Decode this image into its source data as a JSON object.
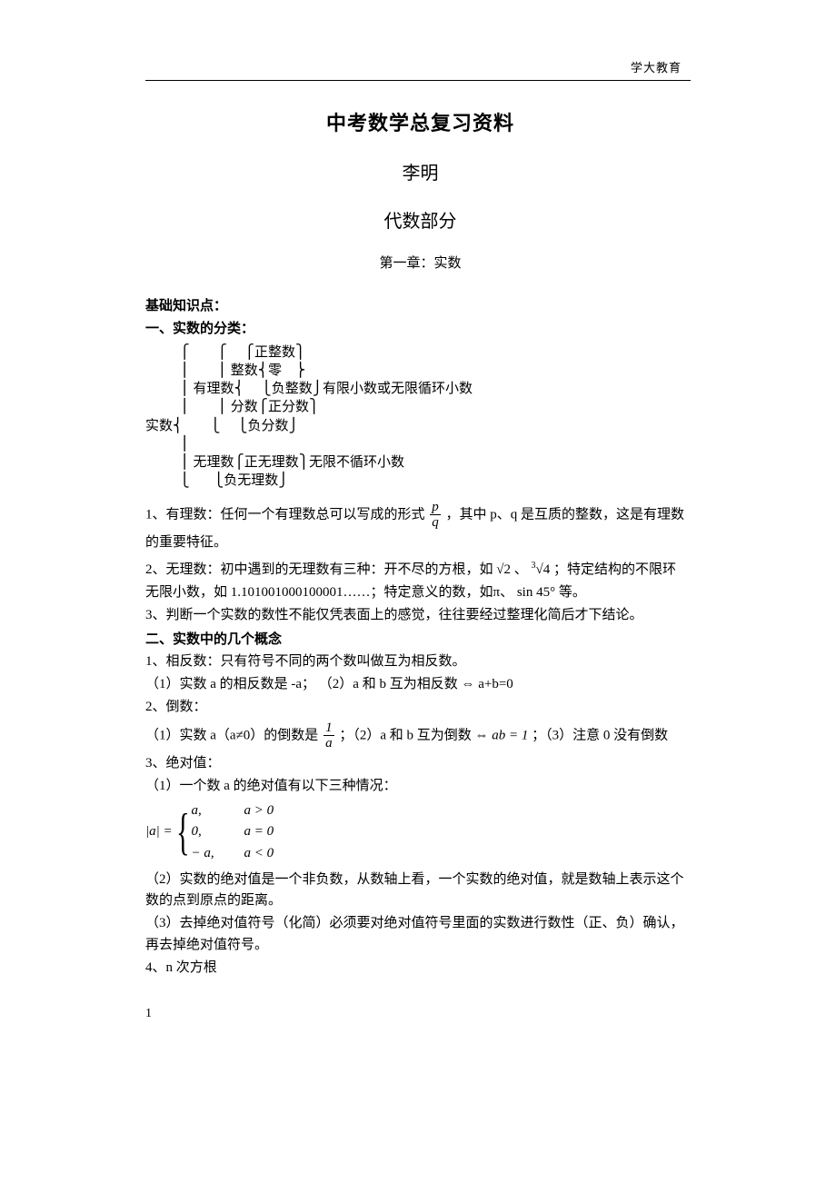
{
  "header": {
    "brand": "学大教育"
  },
  "title": "中考数学总复习资料",
  "author": "李明",
  "section": "代数部分",
  "chapter": "第一章：实数",
  "h_basic": "基础知识点：",
  "h1": "一、实数的分类：",
  "tree": "          ⎧        ⎧     ⎧正整数⎫\n          ⎪        ⎪ 整数⎨零    ⎬\n          ⎪ 有理数⎨     ⎩负整数⎭有限小数或无限循环小数\n          ⎪        ⎪ 分数⎧正分数⎫\n实数⎨        ⎩     ⎩负分数⎭\n          ⎪\n          ⎪ 无理数⎧正无理数⎫无限不循环小数\n          ⎩       ⎩负无理数⎭",
  "p1a": "1、有理数：任何一个有理数总可以写成的形式",
  "p1b": "，其中 p、q 是互质的整数，这是有理数",
  "p1c": "的重要特征。",
  "frac_pq": {
    "num": "p",
    "den": "q"
  },
  "p2a": "2、无理数：初中遇到的无理数有三种：开不尽的方根，如",
  "p2r1": "√2",
  "p2sep": "、",
  "p2r2_idx": "3",
  "p2r2": "√4",
  "p2b": "；特定结构的不限环",
  "p2c": "无限小数，如 1.101001000100001……；特定意义的数，如π、",
  "p2sin": "sin 45°",
  "p2d": " 等。",
  "p3": "3、判断一个实数的数性不能仅凭表面上的感觉，往往要经过整理化简后才下结论。",
  "h2": "二、实数中的几个概念",
  "c1": "1、相反数：只有符号不同的两个数叫做互为相反数。",
  "c1a": "（1）实数 a 的相反数是 -a；   （2）a 和 b 互为相反数 ⇔ a+b=0",
  "c2": "2、倒数：",
  "c2a_pre": "（1）实数 a（a≠0）的倒数是",
  "frac_1a": {
    "num": "1",
    "den": "a"
  },
  "c2a_mid": "；（2）a 和 b 互为倒数 ⇔ ",
  "c2a_eq": "ab = 1",
  "c2a_post": "；（3）注意 0 没有倒数",
  "c3": "3、绝对值：",
  "c3a": "（1）一个数 a 的绝对值有以下三种情况：",
  "abs_left": "|a| =",
  "abs_rows": [
    {
      "l": "a,",
      "r": "a > 0"
    },
    {
      "l": "0,",
      "r": "a = 0"
    },
    {
      "l": "− a,",
      "r": "a < 0"
    }
  ],
  "c3b": "（2）实数的绝对值是一个非负数，从数轴上看，一个实数的绝对值，就是数轴上表示这个数的点到原点的距离。",
  "c3c": "（3）去掉绝对值符号（化简）必须要对绝对值符号里面的实数进行数性（正、负）确认，再去掉绝对值符号。",
  "c4": "4、n 次方根",
  "pagenum": "1"
}
